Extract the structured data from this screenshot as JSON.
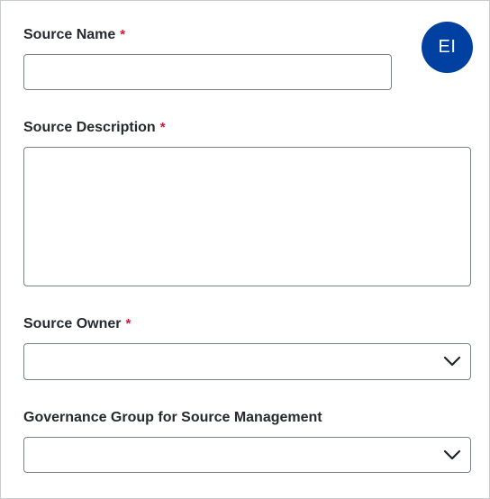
{
  "form": {
    "source_name": {
      "label": "Source Name",
      "required_marker": "*",
      "value": "",
      "placeholder": ""
    },
    "source_description": {
      "label": "Source Description",
      "required_marker": "*",
      "value": "",
      "placeholder": ""
    },
    "source_owner": {
      "label": "Source Owner",
      "required_marker": "*",
      "selected": ""
    },
    "governance_group": {
      "label": "Governance Group for Source Management",
      "selected": ""
    }
  },
  "avatar": {
    "initials": "EI",
    "color": "#0040a0"
  },
  "icons": {
    "dropdown": "chevron-down-icon"
  },
  "colors": {
    "required": "#d1193b",
    "border": "#7a818a"
  }
}
